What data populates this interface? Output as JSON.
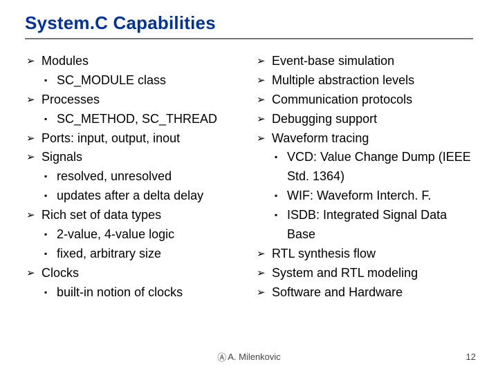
{
  "title": "System.C Capabilities",
  "left": {
    "items": [
      {
        "label": "Modules",
        "sub": [
          {
            "label": "SC_MODULE class"
          }
        ]
      },
      {
        "label": "Processes",
        "sub": [
          {
            "label": "SC_METHOD, SC_THREAD"
          }
        ]
      },
      {
        "label": "Ports: input, output, inout"
      },
      {
        "label": "Signals",
        "sub": [
          {
            "label": "resolved, unresolved"
          },
          {
            "label": "updates after a delta delay"
          }
        ]
      },
      {
        "label": "Rich set of data types",
        "sub": [
          {
            "label": "2-value, 4-value logic"
          },
          {
            "label": "fixed, arbitrary size"
          }
        ]
      },
      {
        "label": "Clocks",
        "sub": [
          {
            "label": "built-in notion of clocks"
          }
        ]
      }
    ]
  },
  "right": {
    "items": [
      {
        "label": "Event-base simulation"
      },
      {
        "label": "Multiple abstraction levels"
      },
      {
        "label": "Communication protocols"
      },
      {
        "label": "Debugging support"
      },
      {
        "label": "Waveform tracing",
        "sub": [
          {
            "label": "VCD: Value Change Dump (IEEE Std. 1364)"
          },
          {
            "label": "WIF: Waveform Interch. F."
          },
          {
            "label": "ISDB: Integrated Signal Data Base"
          }
        ]
      },
      {
        "label": "RTL synthesis flow"
      },
      {
        "label": "System and RTL modeling"
      },
      {
        "label": "Software and Hardware"
      }
    ]
  },
  "footer": {
    "copyright_symbol": "Ⓐ",
    "author": "A. Milenkovic",
    "page": "12"
  }
}
